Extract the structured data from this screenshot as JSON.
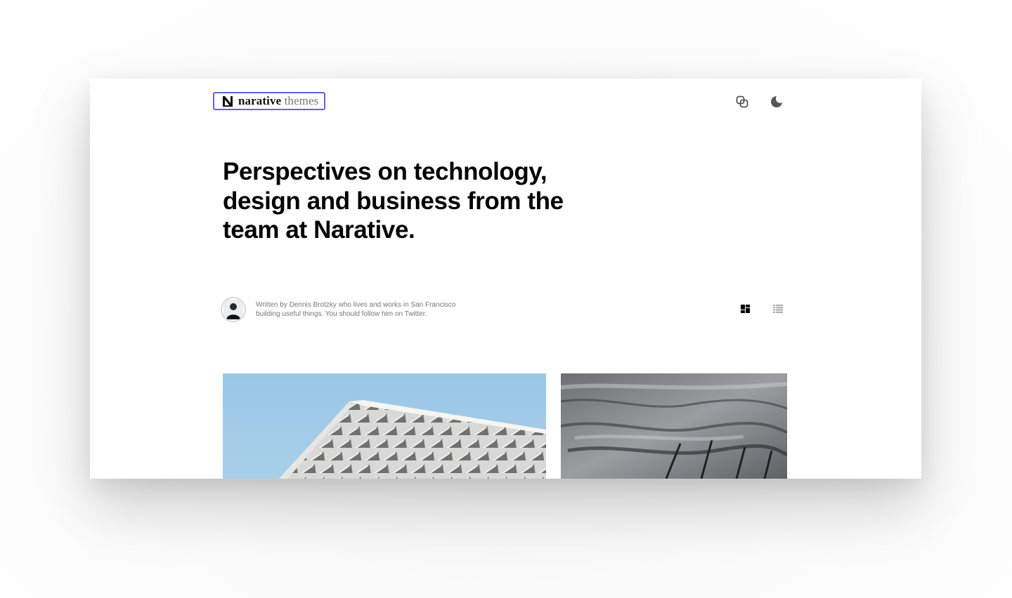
{
  "header": {
    "logo": {
      "brand": "narative",
      "suffix": "themes",
      "mark_icon": "narative-n-logo-icon",
      "border_color": "#6166dc"
    },
    "actions": [
      {
        "icon": "copy-link-icon"
      },
      {
        "icon": "moon-icon"
      }
    ]
  },
  "hero": {
    "headline": "Perspectives on technology, design and business from the team at Narative."
  },
  "author": {
    "avatar_icon": "avatar",
    "bio": "Written by Dennis Brotzky who lives and works in San Francisco building useful things. You should follow him on Twitter."
  },
  "view_toggle": {
    "grid_icon": "grid-view-icon",
    "list_icon": "list-view-icon",
    "active": "grid"
  },
  "articles": [
    {
      "image": "architecture-photo"
    },
    {
      "image": "rock-texture-photo"
    }
  ],
  "colors": {
    "accent": "#6166dc",
    "text": "#000000",
    "muted": "#777777"
  }
}
